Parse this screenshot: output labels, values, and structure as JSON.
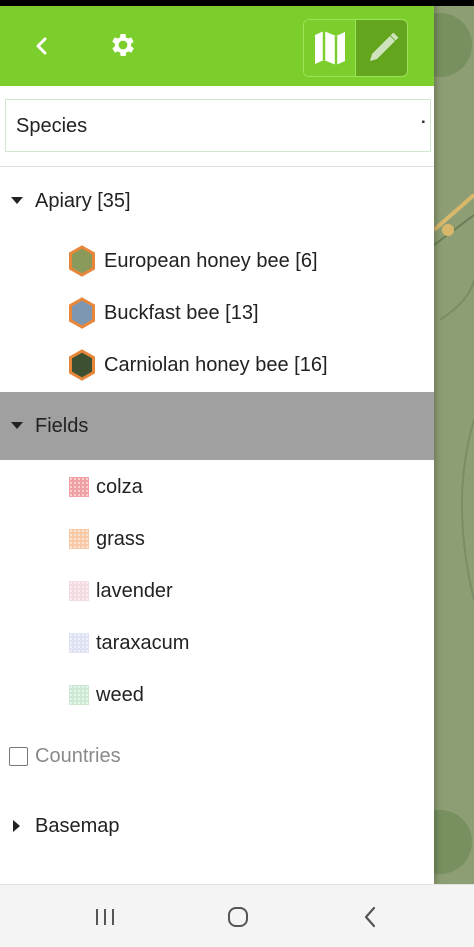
{
  "app_bar": {
    "back_icon": "back-chevron-icon",
    "settings_icon": "gear-icon",
    "map_mode_icon": "map-icon",
    "edit_mode_icon": "pencil-icon",
    "color": "#7cce2c"
  },
  "species_select": {
    "value": "Species"
  },
  "layers": {
    "apiary": {
      "label": "Apiary [35]",
      "expanded": true,
      "items": [
        {
          "label": "European honey bee [6]",
          "fill": "#8a9a5b",
          "stroke": "#e8873a"
        },
        {
          "label": "Buckfast bee [13]",
          "fill": "#7d97b2",
          "stroke": "#e8873a"
        },
        {
          "label": "Carniolan honey bee [16]",
          "fill": "#3d5132",
          "stroke": "#e8873a"
        }
      ]
    },
    "fields": {
      "label": "Fields",
      "expanded": true,
      "selected": true,
      "items": [
        {
          "label": "colza",
          "color": "#f0a0a4"
        },
        {
          "label": "grass",
          "color": "#f8c9a6"
        },
        {
          "label": "lavender",
          "color": "#f3dbe2"
        },
        {
          "label": "taraxacum",
          "color": "#dfe2f2"
        },
        {
          "label": "weed",
          "color": "#cde8d3"
        }
      ]
    },
    "countries": {
      "label": "Countries",
      "checked": false
    },
    "basemap": {
      "label": "Basemap",
      "expanded": false
    }
  },
  "system_nav": {
    "recents_icon": "recents-icon",
    "home_icon": "home-icon",
    "back_icon": "back-icon"
  }
}
